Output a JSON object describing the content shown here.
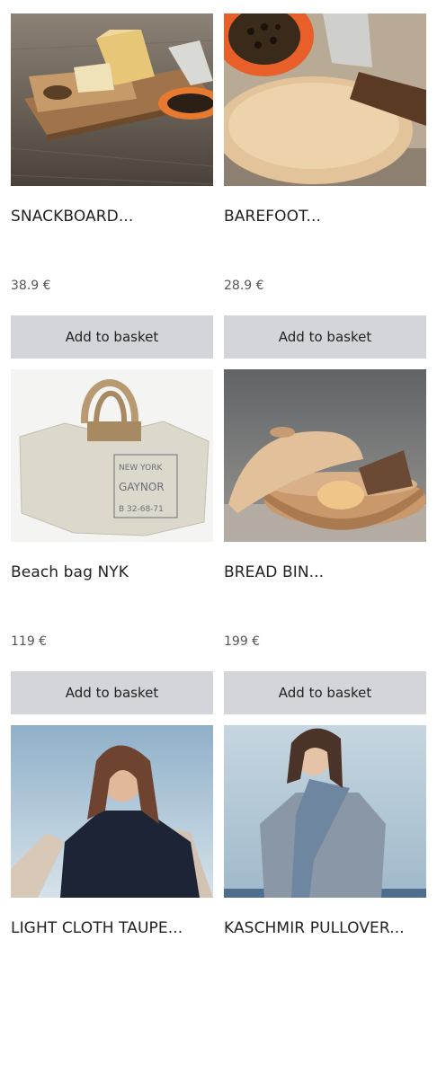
{
  "products": [
    {
      "title": "SNACKBOARD...",
      "price": "38.9 €",
      "button": "Add to basket",
      "image": "snackboard-with-cheese-and-papaya"
    },
    {
      "title": "BAREFOOT...",
      "price": "28.9 €",
      "button": "Add to basket",
      "image": "round-board-with-papaya-and-knife"
    },
    {
      "title": "Beach bag NYK",
      "price": "119 €",
      "button": "Add to basket",
      "image": "canvas-beach-bag"
    },
    {
      "title": "BREAD BIN...",
      "price": "199 €",
      "button": "Add to basket",
      "image": "wooden-bread-bin"
    },
    {
      "title": "LIGHT CLOTH TAUPE...",
      "price": "",
      "button": "",
      "image": "woman-with-taupe-scarf"
    },
    {
      "title": "KASCHMIR PULLOVER...",
      "price": "",
      "button": "",
      "image": "woman-in-grey-cashmere-pullover"
    }
  ],
  "colors": {
    "button_bg": "#d3d5db",
    "price_text": "#555555",
    "title_text": "#222222"
  }
}
